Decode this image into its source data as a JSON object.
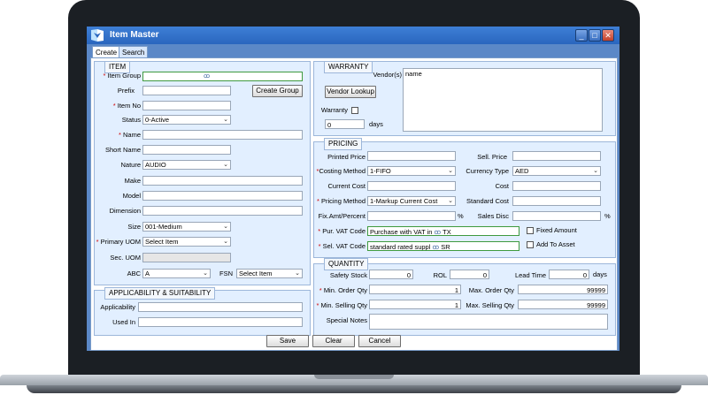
{
  "window": {
    "title": "Item Master"
  },
  "tabs": [
    {
      "label": "Create"
    },
    {
      "label": "Search"
    }
  ],
  "item": {
    "legend": "ITEM",
    "item_group_label": "Item Group",
    "prefix_label": "Prefix",
    "create_group_label": "Create Group",
    "item_no_label": "Item No",
    "status_label": "Status",
    "status_value": "0-Active",
    "name_label": "Name",
    "short_name_label": "Short Name",
    "nature_label": "Nature",
    "nature_value": "AUDIO",
    "make_label": "Make",
    "model_label": "Model",
    "dimension_label": "Dimension",
    "size_label": "Size",
    "size_value": "001-Medium",
    "primary_uom_label": "Primary UOM",
    "primary_uom_value": "Select Item",
    "sec_uom_label": "Sec. UOM",
    "abc_label": "ABC",
    "abc_value": "A",
    "fsn_label": "FSN",
    "fsn_value": "Select Item"
  },
  "applicability": {
    "legend": "APPLICABILITY & SUITABILITY",
    "applicability_label": "Applicability",
    "used_in_label": "Used In"
  },
  "warranty": {
    "legend": "WARRANTY",
    "vendors_label": "Vendor(s)",
    "vendor_lookup_label": "Vendor Lookup",
    "vendor_name": "name",
    "warranty_label": "Warranty",
    "days_value": "0",
    "days_label": "days"
  },
  "pricing": {
    "legend": "PRICING",
    "printed_price_label": "Printed Price",
    "sell_price_label": "Sell. Price",
    "costing_method_label": "Costing Method",
    "costing_method_value": "1-FIFO",
    "currency_type_label": "Currency Type",
    "currency_type_value": "AED",
    "current_cost_label": "Current Cost",
    "cost_label": "Cost",
    "pricing_method_label": "Pricing Method",
    "pricing_method_value": "1-Markup Current Cost",
    "standard_cost_label": "Standard Cost",
    "fix_amt_label": "Fix.Amt/Percent",
    "percent_sign": "%",
    "sales_disc_label": "Sales Disc",
    "pur_vat_label": "Pur. VAT Code",
    "pur_vat_value": "Purchase with VAT in",
    "pur_vat_code": "TX",
    "fixed_amount_label": "Fixed Amount",
    "sel_vat_label": "Sel. VAT Code",
    "sel_vat_value": "standard rated suppl",
    "sel_vat_code": "SR",
    "add_to_asset_label": "Add To Asset"
  },
  "quantity": {
    "legend": "QUANTITY",
    "safety_stock_label": "Safety Stock",
    "safety_stock_value": "0",
    "rol_label": "ROL",
    "rol_value": "0",
    "lead_time_label": "Lead Time",
    "lead_time_value": "0",
    "days_label": "days",
    "min_order_label": "Min. Order Qty",
    "min_order_value": "1",
    "max_order_label": "Max. Order Qty",
    "max_order_value": "99999",
    "min_selling_label": "Min. Selling Qty",
    "min_selling_value": "1",
    "max_selling_label": "Max. Selling Qty",
    "max_selling_value": "99999",
    "special_notes_label": "Special Notes"
  },
  "footer": {
    "save_label": "Save",
    "clear_label": "Clear",
    "cancel_label": "Cancel"
  },
  "icons": {
    "binoculars": "binoculars-icon",
    "logo": "app-logo-icon"
  },
  "colors": {
    "titlebar": "#2a66be",
    "group_bg": "#e2efff",
    "required": "#d10000"
  }
}
